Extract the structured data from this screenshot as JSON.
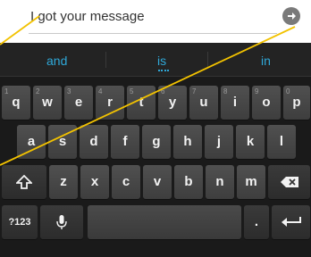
{
  "compose": {
    "message_text": "I got your message",
    "send_icon": "send-arrow-icon"
  },
  "suggestions": {
    "left": "and",
    "center": "is",
    "right": "in"
  },
  "keyboard": {
    "row1": [
      {
        "label": "q",
        "hint": "1"
      },
      {
        "label": "w",
        "hint": "2"
      },
      {
        "label": "e",
        "hint": "3"
      },
      {
        "label": "r",
        "hint": "4"
      },
      {
        "label": "t",
        "hint": "5"
      },
      {
        "label": "y",
        "hint": "6"
      },
      {
        "label": "u",
        "hint": "7"
      },
      {
        "label": "i",
        "hint": "8"
      },
      {
        "label": "o",
        "hint": "9"
      },
      {
        "label": "p",
        "hint": "0"
      }
    ],
    "row2": [
      "a",
      "s",
      "d",
      "f",
      "g",
      "h",
      "j",
      "k",
      "l"
    ],
    "row3": [
      "z",
      "x",
      "c",
      "v",
      "b",
      "n",
      "m"
    ],
    "symbols_label": "?123",
    "period_label": ".",
    "icons": {
      "shift": "shift-arrow-icon",
      "delete": "backspace-icon",
      "mic": "microphone-icon",
      "enter": "enter-return-icon"
    }
  },
  "colors": {
    "suggestion": "#2fa8d8",
    "callout_line": "#f2c200",
    "keyboard_bg": "#1a1a1a"
  }
}
